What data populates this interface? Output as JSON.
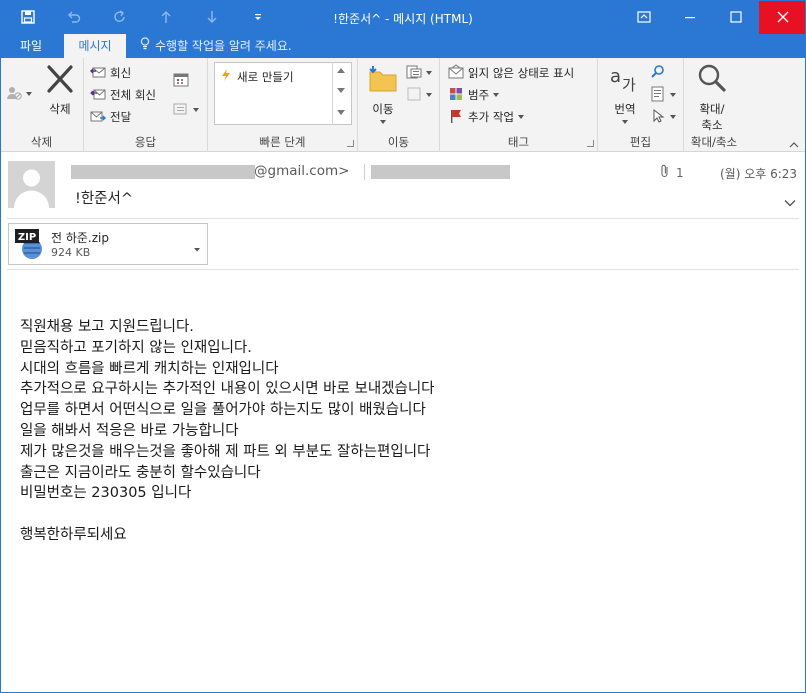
{
  "window": {
    "title": "!한준서^ - 메시지 (HTML)",
    "accent_color": "#2b78d4",
    "close_color": "#e81123",
    "quick_access": [
      {
        "icon": "save-icon"
      },
      {
        "icon": "undo-icon"
      },
      {
        "icon": "redo-icon"
      },
      {
        "icon": "previous-item-icon"
      },
      {
        "icon": "next-item-icon"
      },
      {
        "icon": "customize-quick-access-icon"
      }
    ],
    "controls": [
      {
        "icon": "ribbon-display-options-icon"
      },
      {
        "icon": "minimize-icon"
      },
      {
        "icon": "maximize-icon"
      },
      {
        "icon": "close-icon"
      }
    ]
  },
  "tabs": {
    "file": "파일",
    "message": "메시지",
    "tell_me": "수행할 작업을 알려 주세요."
  },
  "ribbon": {
    "delete_group": {
      "label": "삭제",
      "delete_button": "삭제"
    },
    "respond_group": {
      "label": "응답",
      "reply": "회신",
      "reply_all": "전체 회신",
      "forward": "전달"
    },
    "quick_steps_group": {
      "label": "빠른 단계",
      "new_item": "새로 만들기"
    },
    "move_group": {
      "label": "이동",
      "move_button": "이동"
    },
    "tags_group": {
      "label": "태그",
      "mark_unread": "읽지 않은 상태로 표시",
      "categorize": "범주",
      "follow_up": "추가 작업"
    },
    "editing_group": {
      "label": "편집",
      "translate": "번역"
    },
    "zoom_group": {
      "label": "확대/축소",
      "zoom_line1": "확대/",
      "zoom_line2": "축소"
    }
  },
  "header": {
    "sender_suffix": "@gmail.com>",
    "attachment_count": "1",
    "datetime": "(월) 오후 6:23",
    "subject": "!한준서^"
  },
  "attachment": {
    "badge": "ZIP",
    "name": "전 하준.zip",
    "size": "924 KB"
  },
  "body": {
    "lines": [
      "직원채용 보고 지원드립니다.",
      "믿음직하고 포기하지 않는 인재입니다.",
      "시대의 흐름을 빠르게 캐치하는 인재입니다",
      "추가적으로 요구하시는 추가적인 내용이 있으시면 바로 보내겠습니다",
      "업무를 하면서 어떤식으로 일을 풀어가야 하는지도 많이 배웠습니다",
      "일을 해봐서 적응은 바로 가능합니다",
      "제가 많은것을 배우는것을 좋아해 제 파트 외 부분도 잘하는편입니다",
      "출근은 지금이라도 충분히 할수있습니다",
      "비밀번호는 230305 입니다"
    ],
    "closing": "행복한하루되세요"
  }
}
